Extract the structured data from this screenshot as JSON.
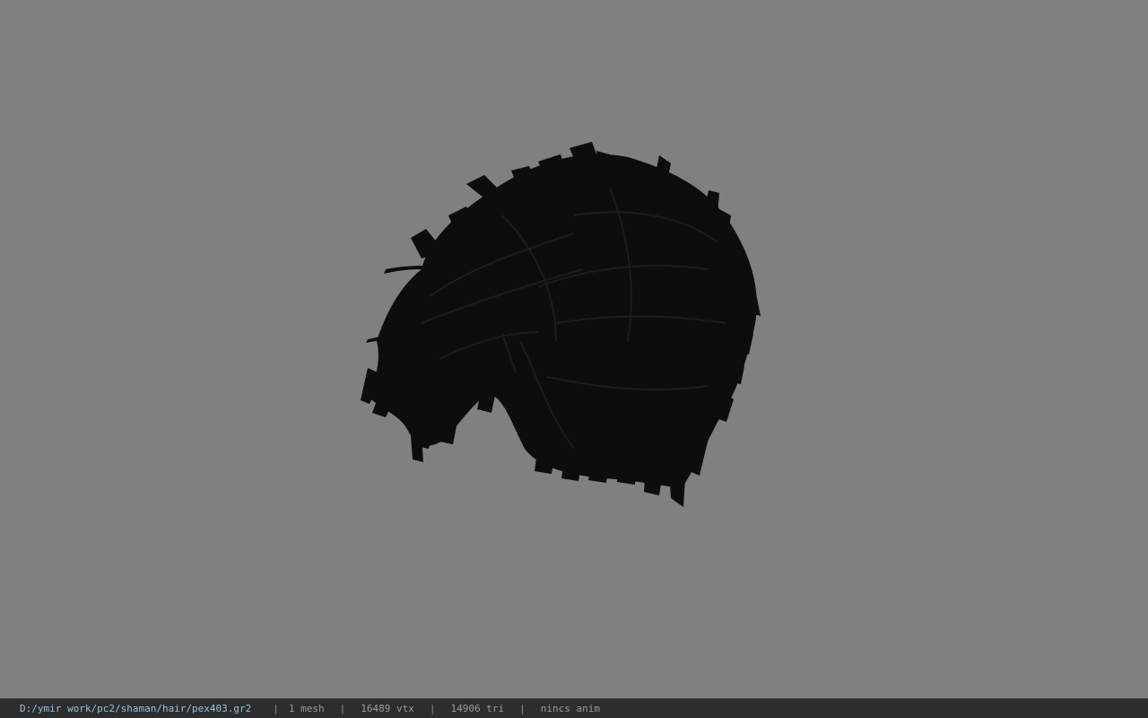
{
  "viewer": {
    "background_color": "#808080",
    "model": {
      "name": "hair-mesh",
      "color": "#0d0d0d",
      "highlight_color": "#1c1c1c"
    }
  },
  "statusbar": {
    "file_path": "D:/ymir work/pc2/shaman/hair/pex403.gr2",
    "separator": "|",
    "mesh_count": "1 mesh",
    "vertex_count": "16489 vtx",
    "triangle_count": "14906 tri",
    "anim_status": "nincs anim",
    "path_color": "#8fc4dd",
    "text_color": "#9a9a9a"
  }
}
